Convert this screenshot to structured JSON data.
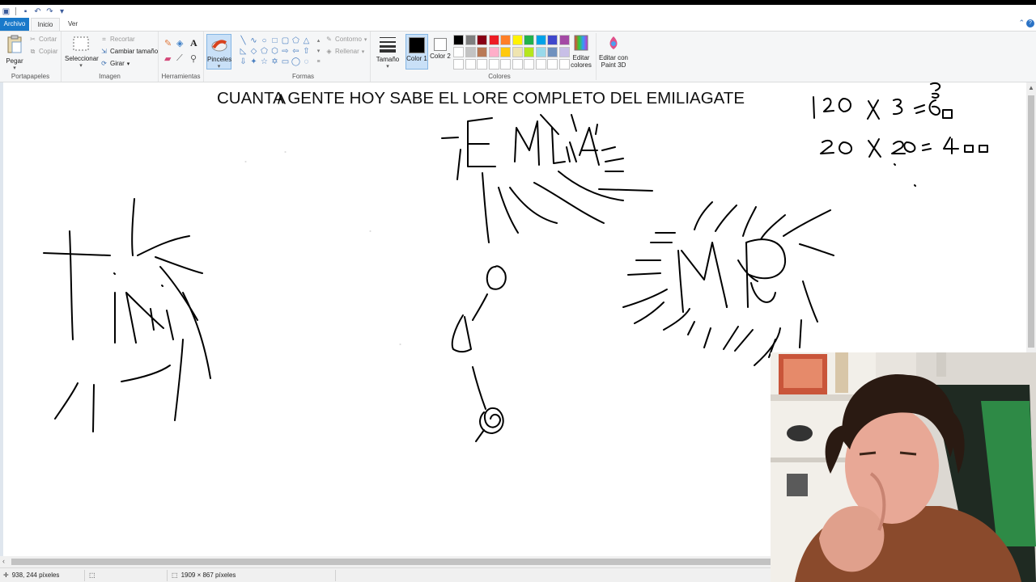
{
  "quick_access": {
    "icons": [
      "paint-app-icon",
      "save-icon",
      "undo-icon",
      "redo-icon",
      "customize-icon"
    ]
  },
  "tabs": {
    "file": "Archivo",
    "home": "Inicio",
    "view": "Ver"
  },
  "ribbon": {
    "clipboard": {
      "paste": "Pegar",
      "cut": "Cortar",
      "copy": "Copiar",
      "label": "Portapapeles"
    },
    "image": {
      "select": "Seleccionar",
      "crop": "Recortar",
      "resize": "Cambiar tamaño",
      "rotate": "Girar",
      "label": "Imagen"
    },
    "tools": {
      "label": "Herramientas",
      "brushes": "Pinceles"
    },
    "shapes": {
      "outline": "Contorno",
      "fill": "Rellenar",
      "label": "Formas"
    },
    "size": "Tamaño",
    "color1": "Color 1",
    "color2": "Color 2",
    "colors": {
      "label": "Colores",
      "palette_row1": [
        "#000000",
        "#7f7f7f",
        "#880015",
        "#ed1c24",
        "#ff7f27",
        "#fff200",
        "#22b14c",
        "#00a2e8",
        "#3f48cc",
        "#a349a4"
      ],
      "palette_row2": [
        "#ffffff",
        "#c3c3c3",
        "#b97a57",
        "#ffaec9",
        "#ffc90e",
        "#efe4b0",
        "#b5e61d",
        "#99d9ea",
        "#7092be",
        "#c8bfe7"
      ],
      "color1_value": "#000000",
      "color2_value": "#ffffff"
    },
    "edit_colors": "Editar colores",
    "edit_paint3d": "Editar con Paint 3D"
  },
  "canvas": {
    "title_text": "CUANTA GENTE HOY SABE EL LORE COMPLETO DEL EMILIAGATE"
  },
  "status": {
    "cursor_pos": "938, 244 píxeles",
    "canvas_size": "1909 × 867 píxeles"
  }
}
